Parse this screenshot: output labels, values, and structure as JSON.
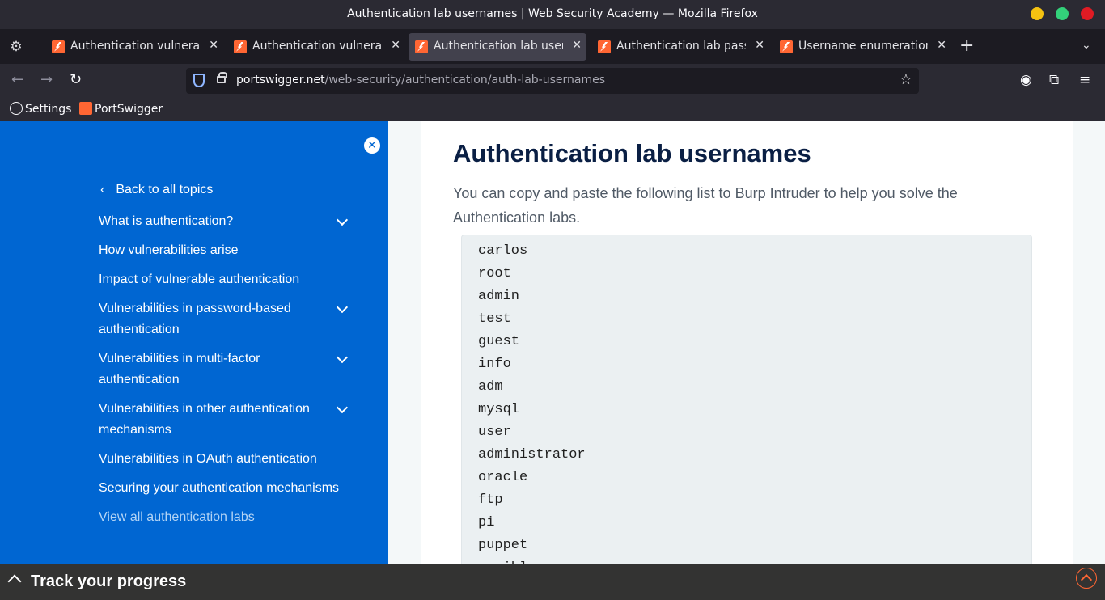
{
  "window": {
    "title": "Authentication lab usernames | Web Security Academy — Mozilla Firefox"
  },
  "tabs": [
    {
      "label": "Authentication vulnerabil",
      "active": false
    },
    {
      "label": "Authentication vulnerabil",
      "active": false
    },
    {
      "label": "Authentication lab userna",
      "active": true
    },
    {
      "label": "Authentication lab passw",
      "active": false
    },
    {
      "label": "Username enumeration v",
      "active": false
    }
  ],
  "urlbar": {
    "domain": "portswigger.net",
    "path": "/web-security/authentication/auth-lab-usernames"
  },
  "bookmarks": [
    {
      "label": "Settings",
      "icon": "globe-icon"
    },
    {
      "label": "PortSwigger",
      "icon": "portswigger-icon"
    }
  ],
  "sidebar": {
    "back_label": "Back to all topics",
    "items": [
      {
        "label": "What is authentication?",
        "expandable": true
      },
      {
        "label": "How vulnerabilities arise",
        "expandable": false
      },
      {
        "label": "Impact of vulnerable authentication",
        "expandable": false
      },
      {
        "label": "Vulnerabilities in password-based authentication",
        "expandable": true
      },
      {
        "label": "Vulnerabilities in multi-factor authentication",
        "expandable": true
      },
      {
        "label": "Vulnerabilities in other authentication mechanisms",
        "expandable": true
      },
      {
        "label": "Vulnerabilities in OAuth authentication",
        "expandable": false
      },
      {
        "label": "Securing your authentication mechanisms",
        "expandable": false
      },
      {
        "label": "View all authentication labs",
        "expandable": false
      }
    ]
  },
  "main": {
    "title": "Authentication lab usernames",
    "intro_before": "You can copy and paste the following list to Burp Intruder to help you solve the ",
    "intro_link": "Authentication",
    "intro_after": " labs.",
    "usernames": [
      "carlos",
      "root",
      "admin",
      "test",
      "guest",
      "info",
      "adm",
      "mysql",
      "user",
      "administrator",
      "oracle",
      "ftp",
      "pi",
      "puppet",
      "ansible"
    ]
  },
  "progress": {
    "label": "Track your progress"
  },
  "colors": {
    "sidebar": "#0066d2",
    "accent": "#ff6633",
    "heading": "#0a1f44"
  }
}
